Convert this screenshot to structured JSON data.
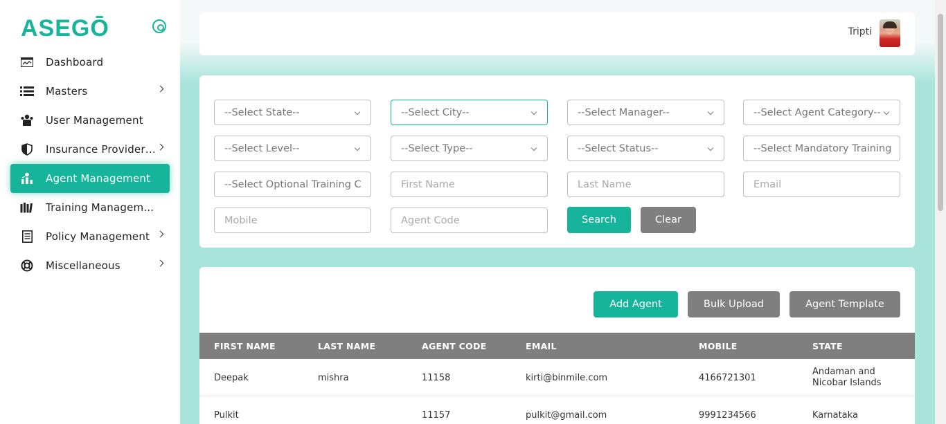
{
  "app": {
    "logo": "ASEGŌ"
  },
  "sidebar": {
    "items": [
      {
        "label": "Dashboard",
        "icon": "dashboard-icon"
      },
      {
        "label": "Masters",
        "icon": "list-icon"
      },
      {
        "label": "User Management",
        "icon": "users-icon"
      },
      {
        "label": "Insurance Provider ...",
        "icon": "shield-icon"
      },
      {
        "label": "Agent Management",
        "icon": "agent-icon"
      },
      {
        "label": "Training Managem...",
        "icon": "books-icon"
      },
      {
        "label": "Policy Management",
        "icon": "document-icon"
      },
      {
        "label": "Miscellaneous",
        "icon": "lifebuoy-icon"
      }
    ],
    "accent": "#16b49a"
  },
  "header": {
    "user_name": "Tripti"
  },
  "filters": {
    "state": "--Select State--",
    "city": "--Select City--",
    "manager": "--Select Manager--",
    "agent_category": "--Select Agent Category--",
    "level": "--Select Level--",
    "type": "--Select Type--",
    "status": "--Select Status--",
    "mandatory_training": "--Select Mandatory Training",
    "optional_training": "--Select Optional Training C",
    "first_name_placeholder": "First Name",
    "last_name_placeholder": "Last Name",
    "email_placeholder": "Email",
    "mobile_placeholder": "Mobile",
    "agent_code_placeholder": "Agent Code",
    "search_label": "Search",
    "clear_label": "Clear"
  },
  "actions": {
    "add_agent": "Add Agent",
    "bulk_upload": "Bulk Upload",
    "agent_template": "Agent Template"
  },
  "table": {
    "columns": [
      "FIRST NAME",
      "LAST NAME",
      "AGENT CODE",
      "EMAIL",
      "MOBILE",
      "STATE"
    ],
    "rows": [
      [
        "Deepak",
        "mishra",
        "11158",
        "kirti@binmile.com",
        "4166721301",
        "Andaman and Nicobar Islands"
      ],
      [
        "Pulkit",
        "",
        "11157",
        "pulkit@gmail.com",
        "9991234566",
        "Karnataka"
      ]
    ]
  }
}
